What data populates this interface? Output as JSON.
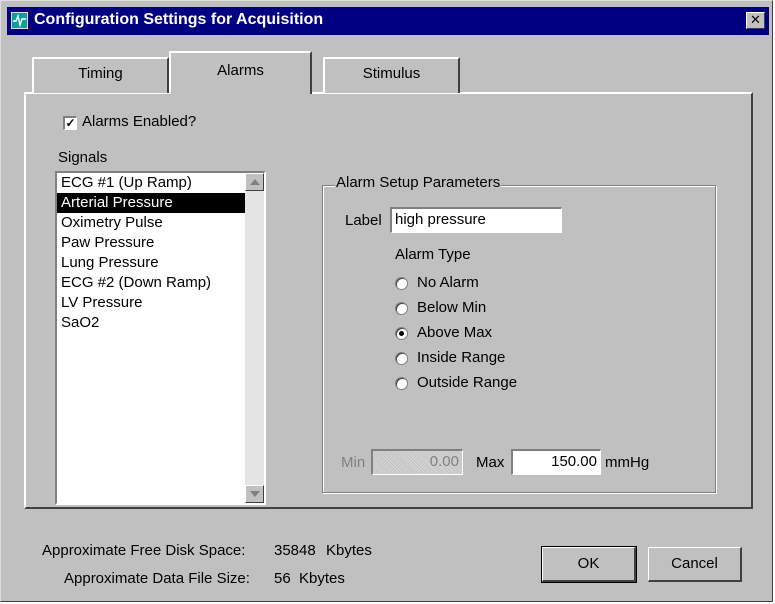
{
  "window": {
    "title": "Configuration Settings for Acquisition",
    "close_glyph": "✕"
  },
  "tabs": [
    {
      "label": "Timing",
      "active": false
    },
    {
      "label": "Alarms",
      "active": true
    },
    {
      "label": "Stimulus",
      "active": false
    }
  ],
  "alarms_enabled": {
    "label": "Alarms Enabled?",
    "checked": true,
    "check_glyph": "✓"
  },
  "signals": {
    "label": "Signals",
    "items": [
      "ECG #1 (Up Ramp)",
      "Arterial Pressure",
      "Oximetry Pulse",
      "Paw Pressure",
      "Lung Pressure",
      "ECG #2 (Down Ramp)",
      "LV Pressure",
      "SaO2"
    ],
    "selected_index": 1
  },
  "alarm_setup": {
    "title": "Alarm Setup Parameters",
    "label_caption": "Label",
    "label_value": "high pressure",
    "type_caption": "Alarm Type",
    "types": [
      "No Alarm",
      "Below Min",
      "Above Max",
      "Inside Range",
      "Outside Range"
    ],
    "selected_type_index": 2,
    "min_caption": "Min",
    "min_value": "0.00",
    "max_caption": "Max",
    "max_value": "150.00",
    "unit": "mmHg"
  },
  "footer": {
    "free_disk_label": "Approximate Free Disk Space:",
    "free_disk_value": "35848",
    "free_disk_unit": "Kbytes",
    "file_size_label": "Approximate Data File Size:",
    "file_size_value": "56",
    "file_size_unit": "Kbytes"
  },
  "buttons": {
    "ok": "OK",
    "cancel": "Cancel"
  },
  "colors": {
    "titlebar": "#000080",
    "face": "#c0c0c0",
    "selection": "#000000"
  }
}
